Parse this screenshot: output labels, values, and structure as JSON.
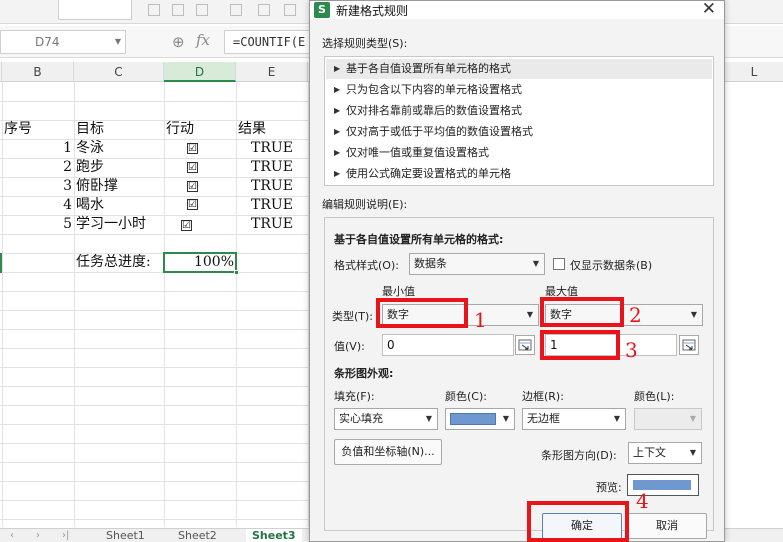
{
  "spreadsheet": {
    "name_box": "D74",
    "formula": "=COUNTIF(E",
    "columns": [
      "B",
      "C",
      "D",
      "E",
      "L"
    ],
    "selected_column": "D",
    "headers": {
      "seq": "序号",
      "goal": "目标",
      "action": "行动",
      "result": "结果"
    },
    "rows": [
      {
        "seq": "1",
        "goal": "冬泳",
        "check": "☑",
        "result": "TRUE"
      },
      {
        "seq": "2",
        "goal": "跑步",
        "check": "☑",
        "result": "TRUE"
      },
      {
        "seq": "3",
        "goal": "俯卧撑",
        "check": "☑",
        "result": "TRUE"
      },
      {
        "seq": "4",
        "goal": "喝水",
        "check": "☑",
        "result": "TRUE"
      },
      {
        "seq": "5",
        "goal": "学习一小时",
        "check": "☑",
        "result": "TRUE"
      }
    ],
    "progress_label": "任务总进度:",
    "progress_value": "100%",
    "sheets": [
      "Sheet1",
      "Sheet2",
      "Sheet3"
    ],
    "active_sheet": "Sheet3"
  },
  "dialog": {
    "title": "新建格式规则",
    "select_rule_type_label": "选择规则类型(S):",
    "rule_types": [
      "基于各自值设置所有单元格的格式",
      "只为包含以下内容的单元格设置格式",
      "仅对排名靠前或靠后的数值设置格式",
      "仅对高于或低于平均值的数值设置格式",
      "仅对唯一值或重复值设置格式",
      "使用公式确定要设置格式的单元格"
    ],
    "selected_rule_index": 0,
    "edit_description_label": "编辑规则说明(E):",
    "description_heading": "基于各自值设置所有单元格的格式:",
    "format_style_label": "格式样式(O):",
    "format_style_value": "数据条",
    "show_bar_only_label": "仅显示数据条(B)",
    "min_header": "最小值",
    "max_header": "最大值",
    "type_label": "类型(T):",
    "min_type": "数字",
    "max_type": "数字",
    "value_label": "值(V):",
    "min_value": "0",
    "max_value": "1",
    "bar_appearance_label": "条形图外观:",
    "fill_label": "填充(F):",
    "fill_value": "实心填充",
    "color_label": "颜色(C):",
    "border_label": "边框(R):",
    "border_value": "无边框",
    "border_color_label": "颜色(L):",
    "negative_axis_button": "负值和坐标轴(N)...",
    "bar_direction_label": "条形图方向(D):",
    "bar_direction_value": "上下文",
    "preview_label": "预览:",
    "ok_button": "确定",
    "cancel_button": "取消",
    "bar_color": "#6f98d0"
  },
  "annotations": {
    "n1": "1",
    "n2": "2",
    "n3": "3",
    "n4": "4"
  },
  "colors": {
    "highlight_red": "#e8141a",
    "selection_green": "#2b8a4c",
    "bar_fill": "#6f98d0"
  },
  "icons": [
    "search-zoom-icon",
    "fx-icon",
    "app-icon",
    "close-icon",
    "range-picker-icon",
    "checkbox-checked-icon",
    "chevron-down-icon",
    "triangle-right-icon"
  ]
}
